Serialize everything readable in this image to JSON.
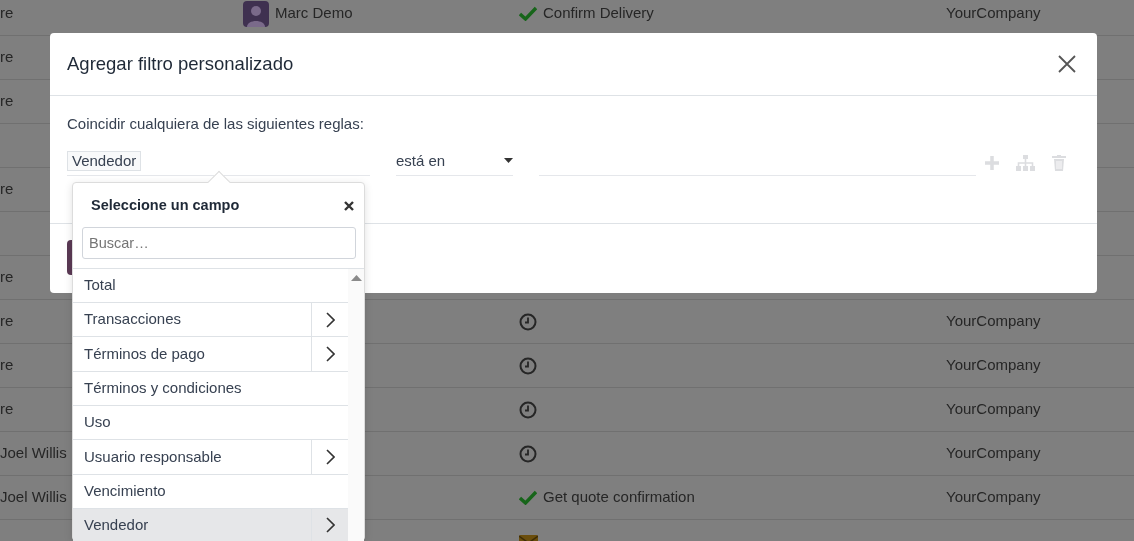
{
  "background_list": {
    "rows": [
      {
        "column_1": "re",
        "user": {
          "name": "Marc Demo"
        },
        "activity": {
          "kind": "done",
          "text": "Confirm Delivery"
        },
        "company": "YourCompany"
      },
      {
        "column_1": "re"
      },
      {
        "column_1": "re"
      },
      {},
      {
        "column_1": "re"
      },
      {},
      {
        "column_1": "re"
      },
      {
        "column_1": "re",
        "activity": {
          "kind": "clock"
        },
        "company": "YourCompany"
      },
      {
        "column_1": "re",
        "activity": {
          "kind": "clock"
        },
        "company": "YourCompany"
      },
      {
        "column_1": "re",
        "activity": {
          "kind": "clock"
        },
        "company": "YourCompany"
      },
      {
        "column_1": "Joel Willis",
        "activity": {
          "kind": "clock"
        },
        "company": "YourCompany"
      },
      {
        "column_1": "Joel Willis",
        "activity": {
          "kind": "done",
          "text": "Get quote confirmation"
        },
        "company": "YourCompany"
      },
      {
        "activity": {
          "kind": "email"
        }
      }
    ]
  },
  "dialog": {
    "title": "Agregar filtro personalizado",
    "intro": "Coincidir cualquiera de las siguientes reglas:",
    "rules": [
      {
        "field": "Vendedor",
        "operator": "está en"
      }
    ]
  },
  "field_popover": {
    "title": "Seleccione un campo",
    "search_placeholder": "Buscar…",
    "items": [
      {
        "label": "Total",
        "has_children": false,
        "selected": false
      },
      {
        "label": "Transacciones",
        "has_children": true,
        "selected": false
      },
      {
        "label": "Términos de pago",
        "has_children": true,
        "selected": false
      },
      {
        "label": "Términos y condiciones",
        "has_children": false,
        "selected": false
      },
      {
        "label": "Uso",
        "has_children": false,
        "selected": false
      },
      {
        "label": "Usuario responsable",
        "has_children": true,
        "selected": false
      },
      {
        "label": "Vencimiento",
        "has_children": false,
        "selected": false
      },
      {
        "label": "Vendedor",
        "has_children": true,
        "selected": true
      }
    ]
  }
}
